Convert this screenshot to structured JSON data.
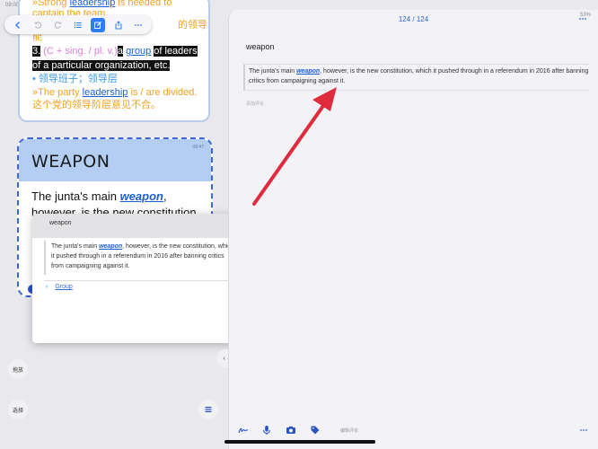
{
  "status": {
    "left_time": "09:00",
    "right_status": "53%"
  },
  "toolbar": {
    "icons": [
      "back-icon",
      "undo-icon",
      "redo-icon",
      "list-icon",
      "edit-icon",
      "share-icon",
      "more-icon"
    ]
  },
  "card1": {
    "line1_prefix": "»Strong ",
    "line1_link": "leadership",
    "line1_suffix": " is needed to",
    "line2": "captain the team.",
    "line3_tail": "的领导才",
    "line4": "能",
    "def_num": "3.",
    "def_pos": "(C + sing. / pl. v.)",
    "def_article": "a",
    "def_link": "group",
    "def_rest": "of leaders",
    "def_line2": "of a particular organization, etc.",
    "zh_def": "• 领导班子；领导层",
    "ex_prefix": "»The party ",
    "ex_link": "leadership",
    "ex_suffix": " is / are divided.",
    "ex_zh": "这个党的领导阶层意见不合。"
  },
  "card2": {
    "title": "WEAPON",
    "time": "09:47",
    "body_prefix": "The junta's main ",
    "body_word": "weapon",
    "body_suffix": ",",
    "body_line2": "however, is the new constitution"
  },
  "popup": {
    "word": "weapon",
    "quote_prefix": "The junta's main ",
    "quote_word": "weapon",
    "quote_suffix": ", however, is the new constitution, which it pushed through in a referendum in 2016 after banning critics from campaigning against it.",
    "group_label": "Group"
  },
  "sidebar": {
    "drag_label": "拖放",
    "select_label": "选择"
  },
  "nav_pill": "‹ · ›",
  "right": {
    "counter": "124 / 124",
    "word": "weapon",
    "quote_prefix": "The junta's main ",
    "quote_word": "weapon",
    "quote_suffix": ", however, is the new constitution, which it pushed through in a referendum in 2016 after banning critics from campaigning against it.",
    "add_comment": "添加评论",
    "bottom_comment": "编辑评论",
    "bottom_icons": [
      "handwriting-icon",
      "microphone-icon",
      "camera-icon",
      "tag-icon"
    ]
  },
  "colors": {
    "accent": "#2f7df6",
    "highlight_red": "#e02b3d",
    "card_header": "#b3cdf3",
    "orange_text": "#f0a21f"
  }
}
